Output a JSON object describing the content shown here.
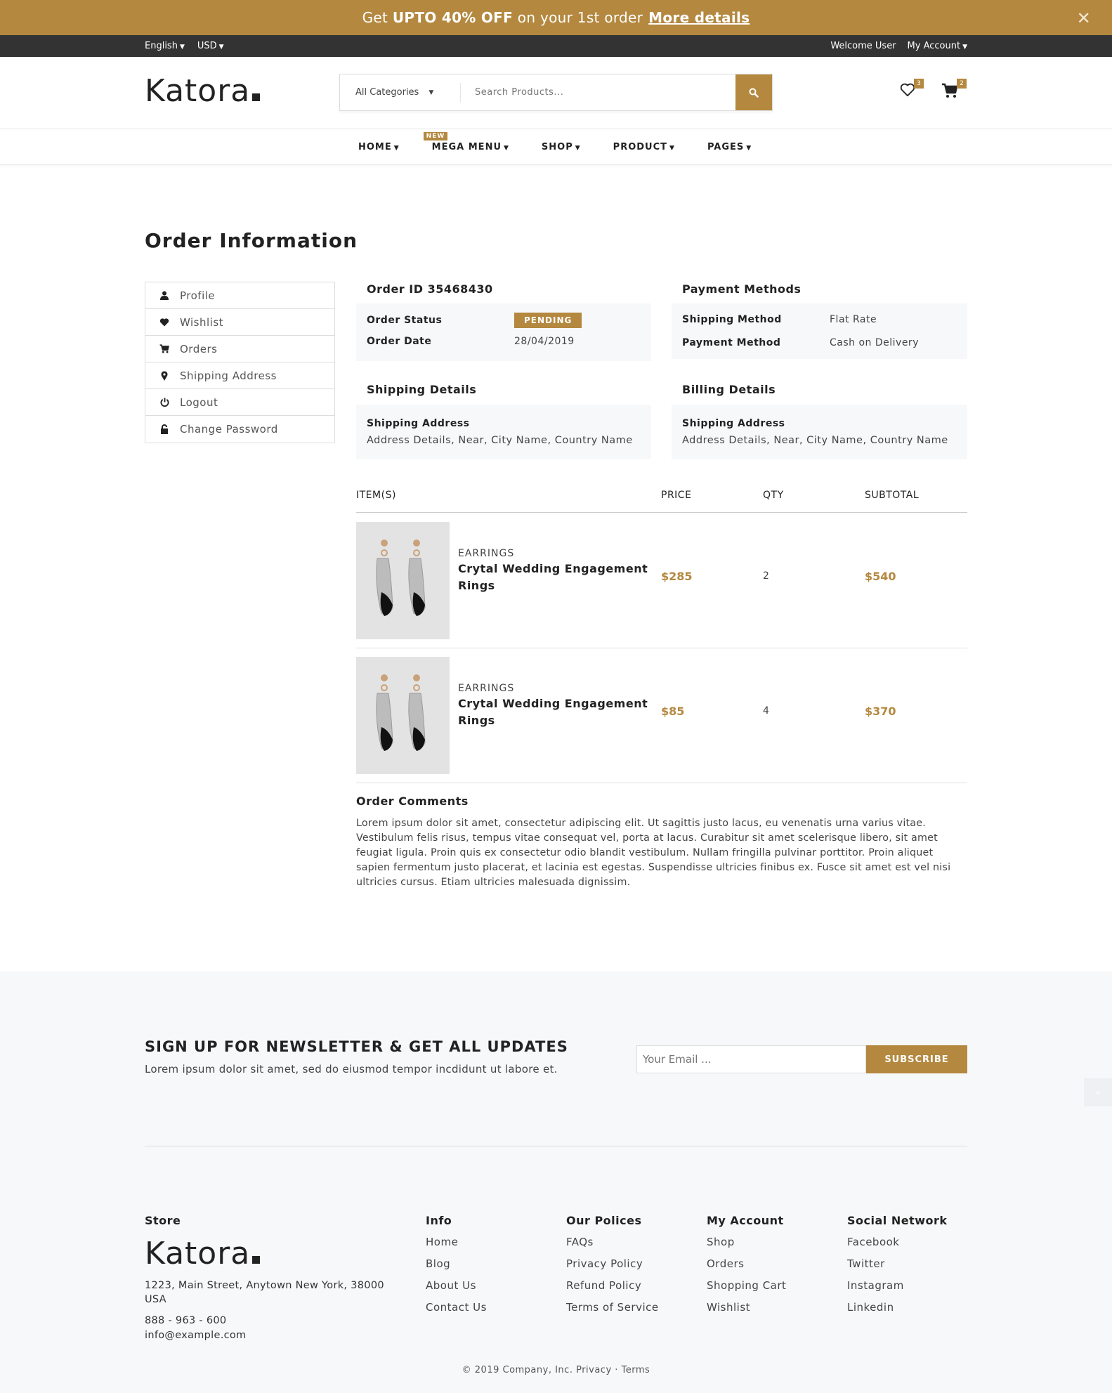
{
  "promo": {
    "prefix": "Get",
    "bold": "UPTO 40% OFF",
    "suffix": "on your 1st order",
    "link": "More details",
    "close": "✕"
  },
  "topbar": {
    "language": "English",
    "currency": "USD",
    "welcome": "Welcome User",
    "account": "My Account"
  },
  "header": {
    "logo": "Katora",
    "search": {
      "category": "All Categories",
      "placeholder": "Search Products..."
    },
    "wishlist_count": "3",
    "cart_count": "2"
  },
  "nav": {
    "items": [
      {
        "label": "HOME"
      },
      {
        "label": "MEGA MENU",
        "badge": "NEW"
      },
      {
        "label": "SHOP"
      },
      {
        "label": "PRODUCT"
      },
      {
        "label": "PAGES"
      }
    ]
  },
  "page": {
    "title": "Order Information"
  },
  "sidebar": {
    "items": [
      {
        "label": "Profile",
        "icon": "user-icon"
      },
      {
        "label": "Wishlist",
        "icon": "heart-icon"
      },
      {
        "label": "Orders",
        "icon": "cart-icon"
      },
      {
        "label": "Shipping Address",
        "icon": "map-pin-icon"
      },
      {
        "label": "Logout",
        "icon": "power-icon"
      },
      {
        "label": "Change Password",
        "icon": "lock-icon"
      }
    ]
  },
  "order": {
    "id_title": "Order ID 35468430",
    "status_label": "Order Status",
    "status_value": "PENDING",
    "date_label": "Order Date",
    "date_value": "28/04/2019"
  },
  "payment": {
    "title": "Payment Methods",
    "shipping_label": "Shipping Method",
    "shipping_value": "Flat Rate",
    "payment_label": "Payment Method",
    "payment_value": "Cash on Delivery"
  },
  "shipping": {
    "title": "Shipping Details",
    "label": "Shipping Address",
    "value": "Address Details, Near, City Name, Country Name"
  },
  "billing": {
    "title": "Billing Details",
    "label": "Shipping Address",
    "value": "Address Details, Near, City Name, Country Name"
  },
  "items_table": {
    "headers": {
      "items": "ITEM(S)",
      "price": "PRICE",
      "qty": "QTY",
      "subtotal": "SUBTOTAL"
    },
    "rows": [
      {
        "category": "EARRINGS",
        "name": "Crytal Wedding Engagement Rings",
        "price": "$285",
        "qty": "2",
        "subtotal": "$540"
      },
      {
        "category": "EARRINGS",
        "name": "Crytal Wedding Engagement Rings",
        "price": "$85",
        "qty": "4",
        "subtotal": "$370"
      }
    ]
  },
  "comments": {
    "title": "Order Comments",
    "text": "Lorem ipsum dolor sit amet, consectetur adipiscing elit. Ut sagittis justo lacus, eu venenatis urna varius vitae. Vestibulum felis risus, tempus vitae consequat vel, porta at lacus. Curabitur sit amet scelerisque libero, sit amet feugiat ligula. Proin quis ex consectetur odio blandit vestibulum. Nullam fringilla pulvinar porttitor. Proin aliquet sapien fermentum justo placerat, et lacinia est egestas. Suspendisse ultricies finibus ex. Fusce sit amet est vel nisi ultricies cursus. Etiam ultricies malesuada dignissim."
  },
  "newsletter": {
    "title": "SIGN UP FOR NEWSLETTER & GET ALL UPDATES",
    "subtitle": "Lorem ipsum dolor sit amet, sed do eiusmod tempor incdidunt ut labore et.",
    "placeholder": "Your Email ...",
    "button": "SUBSCRIBE"
  },
  "footer": {
    "store": {
      "title": "Store",
      "logo": "Katora",
      "address": "1223, Main Street, Anytown New York, 38000 USA",
      "phone": "888 - 963 - 600",
      "email": "info@example.com"
    },
    "info": {
      "title": "Info",
      "links": [
        "Home",
        "Blog",
        "About Us",
        "Contact Us"
      ]
    },
    "policies": {
      "title": "Our Polices",
      "links": [
        "FAQs",
        "Privacy Policy",
        "Refund Policy",
        "Terms of Service"
      ]
    },
    "account": {
      "title": "My Account",
      "links": [
        "Shop",
        "Orders",
        "Shopping Cart",
        "Wishlist"
      ]
    },
    "social": {
      "title": "Social Network",
      "links": [
        "Facebook",
        "Twitter",
        "Instagram",
        "Linkedin"
      ]
    },
    "copyright": "© 2019 Company, Inc. Privacy · Terms"
  },
  "colors": {
    "accent": "#b4883f",
    "dark": "#333333",
    "panel": "#f7f8fa"
  }
}
